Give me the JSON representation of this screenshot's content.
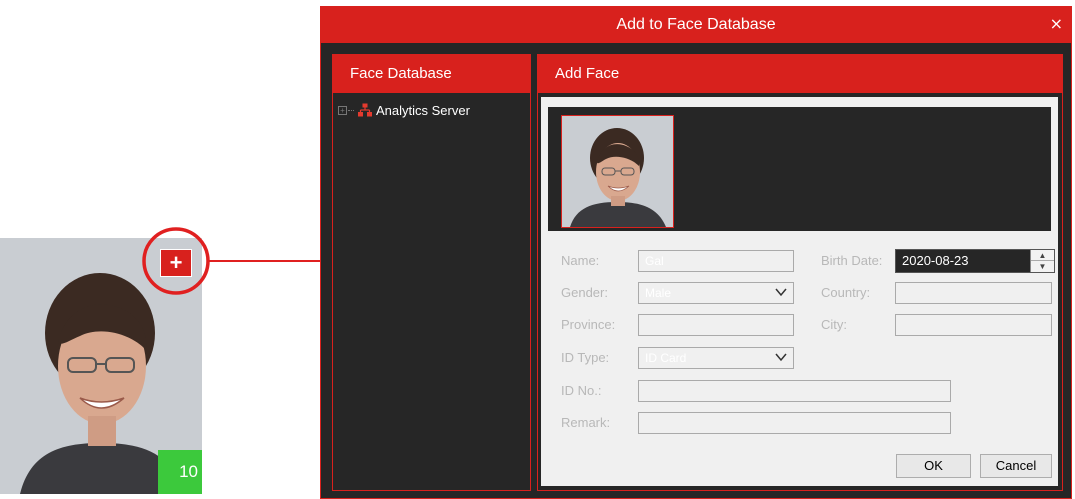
{
  "snapshot": {
    "score": "10",
    "add_symbol": "+"
  },
  "dialog": {
    "title": "Add to Face Database",
    "close_symbol": "×",
    "left_panel": {
      "header": "Face Database",
      "tree": [
        {
          "label": "Analytics Server",
          "expand_symbol": "+"
        }
      ]
    },
    "right_panel": {
      "header": "Add Face",
      "form": {
        "name_label": "Name:",
        "name_value": "Gal",
        "birth_date_label": "Birth Date:",
        "birth_date_value": "2020-08-23",
        "gender_label": "Gender:",
        "gender_value": "Male",
        "country_label": "Country:",
        "country_value": "",
        "province_label": "Province:",
        "province_value": "",
        "city_label": "City:",
        "city_value": "",
        "id_type_label": "ID Type:",
        "id_type_value": "ID Card",
        "id_no_label": "ID No.:",
        "id_no_value": "",
        "remark_label": "Remark:",
        "remark_value": ""
      },
      "ok_label": "OK",
      "cancel_label": "Cancel"
    }
  },
  "colors": {
    "accent": "#d8211d",
    "panel_bg": "#262626",
    "form_bg": "#f0f0f0",
    "score_bg": "#3cc93c"
  }
}
